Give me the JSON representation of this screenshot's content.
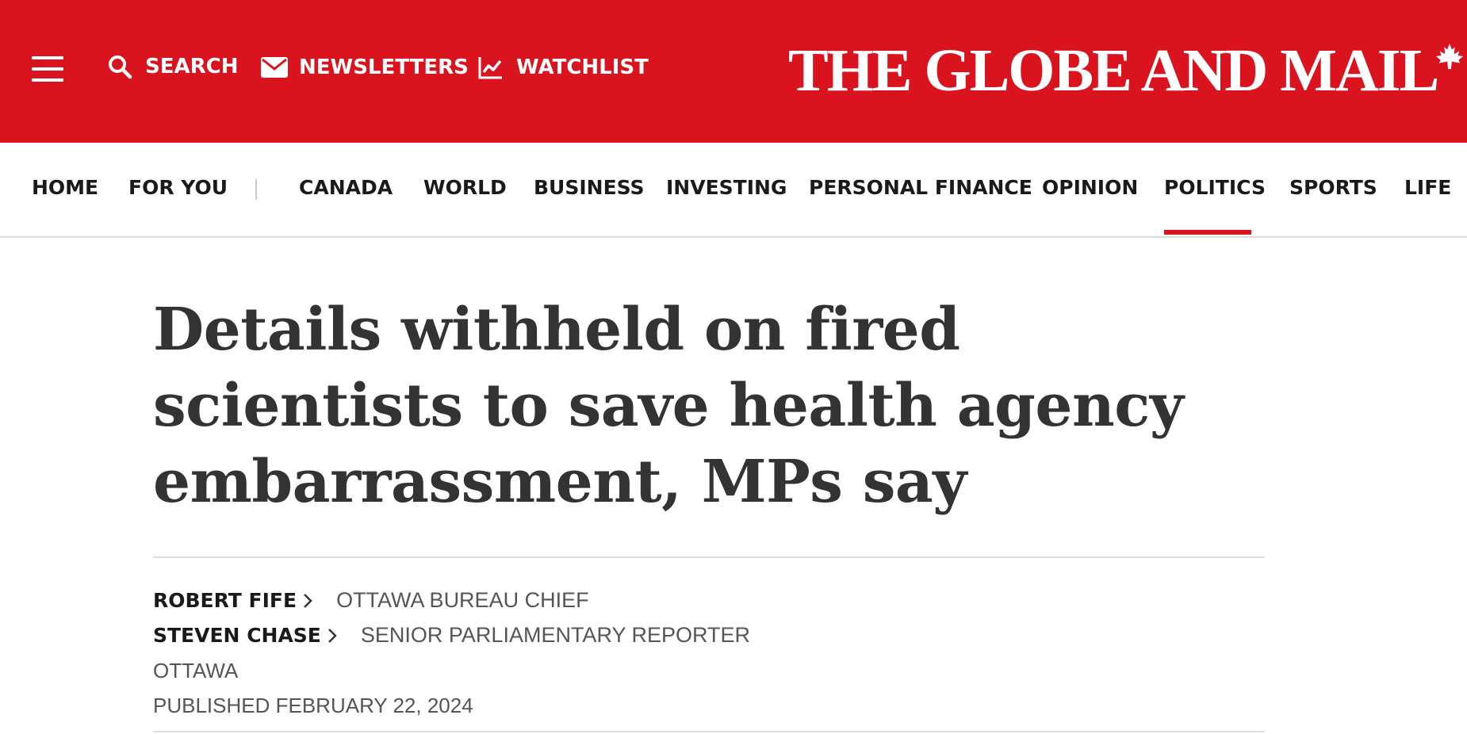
{
  "topbar": {
    "menu_icon": "hamburger-menu-icon",
    "search_label": "SEARCH",
    "newsletters_label": "NEWSLETTERS",
    "watchlist_label": "WATCHLIST",
    "logo_text": "THE GLOBE AND MAIL",
    "background_color": "#d9141f"
  },
  "nav": {
    "items": [
      "HOME",
      "FOR YOU",
      "CANADA",
      "WORLD",
      "BUSINESS",
      "INVESTING",
      "PERSONAL FINANCE",
      "OPINION",
      "POLITICS",
      "SPORTS",
      "LIFE"
    ],
    "active": "POLITICS",
    "accent_color": "#d9141f"
  },
  "article": {
    "headline": "Details withheld on fired scientists to save health agency embarrassment, MPs say",
    "authors": [
      {
        "name": "ROBERT FIFE",
        "role": "OTTAWA BUREAU CHIEF"
      },
      {
        "name": "STEVEN CHASE",
        "role": "SENIOR PARLIAMENTARY REPORTER"
      }
    ],
    "location": "OTTAWA",
    "published": "PUBLISHED FEBRUARY 22, 2024"
  }
}
